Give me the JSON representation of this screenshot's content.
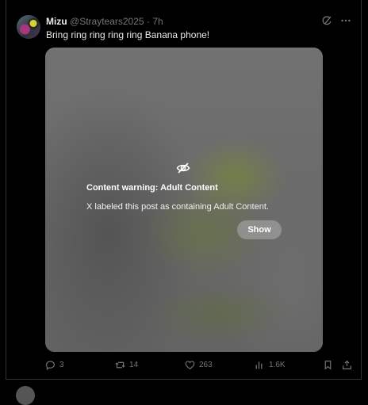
{
  "post": {
    "author_name": "Mizu",
    "author_handle": "@Straytears2025",
    "separator": "·",
    "time": "7h",
    "text": "Bring ring ring ring ring Banana phone!",
    "media": {
      "warning_title": "Content warning: Adult Content",
      "warning_desc": "X labeled this post as containing Adult Content.",
      "show_label": "Show",
      "icon": "eye-off-icon"
    },
    "stats": {
      "replies": "3",
      "reposts": "14",
      "likes": "263",
      "views": "1.6K"
    },
    "header_icons": [
      "grok-icon",
      "more-icon"
    ],
    "action_icons": [
      "reply-icon",
      "repost-icon",
      "like-icon",
      "views-icon",
      "bookmark-icon",
      "share-icon"
    ]
  },
  "colors": {
    "background": "#000000",
    "text": "#e7e9ea",
    "muted": "#71767b",
    "border": "#2f3336"
  }
}
